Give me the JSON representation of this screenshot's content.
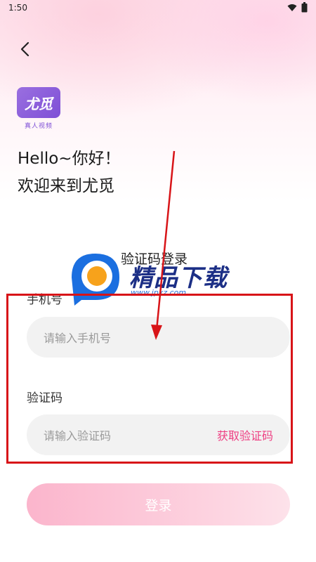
{
  "status_bar": {
    "time": "1:50"
  },
  "logo": {
    "mark": "尤觅",
    "subtitle": "真人视频"
  },
  "greeting": {
    "line1": "Hello~你好！",
    "line2": "欢迎来到尤觅"
  },
  "login_mode": "验证码登录",
  "phone": {
    "label": "手机号",
    "placeholder": "请输入手机号"
  },
  "code": {
    "label": "验证码",
    "placeholder": "请输入验证码",
    "get_code": "获取验证码"
  },
  "login_button": "登录",
  "watermark": {
    "brand": "精品下载",
    "url": "www.jpxz.com"
  },
  "colors": {
    "accent": "#ee3e82",
    "button": "#fbb5cc",
    "input_bg": "#f2f2f2",
    "annotation": "#d81418"
  },
  "icons": {
    "back": "chevron-left-icon",
    "wifi": "wifi-icon",
    "battery": "battery-icon"
  }
}
